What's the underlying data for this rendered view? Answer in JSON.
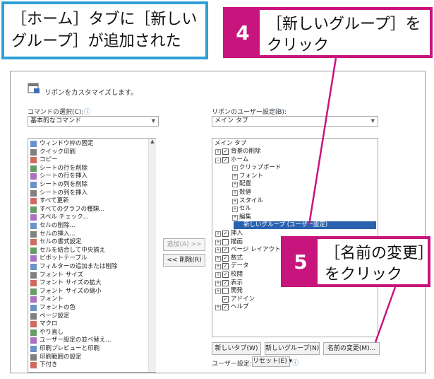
{
  "callout_blue": {
    "line1": "［ホーム］タブに［新しい",
    "line2": "グループ］が追加された"
  },
  "callout_4": {
    "num": "4",
    "line1": "［新しいグループ］を",
    "line2": "クリック"
  },
  "callout_5": {
    "num": "5",
    "line1": "［名前の変更］",
    "line2": "をクリック"
  },
  "dialog": {
    "title": "リボンをカスタマイズします。",
    "left_label": "コマンドの選択(C):",
    "left_combo": "基本的なコマンド",
    "right_label": "リボンのユーザー設定(B):",
    "right_combo": "メイン タブ",
    "commands": [
      "ウィンドウ枠の固定",
      "クイック印刷",
      "コピー",
      "シートの行を削除",
      "シートの行を挿入",
      "シートの列を削除",
      "シートの列を挿入",
      "すべて更新",
      "すべてのグラフの種類...",
      "スペル チェック...",
      "セルの削除...",
      "セルの挿入...",
      "セルの書式設定",
      "セルを結合して中央揃え",
      "ピボットテーブル",
      "フィルターの追加または削除",
      "フォント サイズ",
      "フォント サイズの拡大",
      "フォント サイズの縮小",
      "フォント",
      "フォントの色",
      "ページ設定",
      "マクロ",
      "やり直し",
      "ユーザー設定の並べ替え...",
      "印刷プレビューと印刷",
      "印刷範囲の設定",
      "下付き"
    ],
    "add_button": "追加(A) >>",
    "remove_button": "<< 削除(R)",
    "tree_header": "メイン タブ",
    "tree": [
      {
        "text": "背景の削除",
        "level": 0,
        "plus": true,
        "check": true
      },
      {
        "text": "ホーム",
        "level": 0,
        "plus": true,
        "check": true,
        "minus": true
      },
      {
        "text": "クリップボード",
        "level": 1,
        "plus": true
      },
      {
        "text": "フォント",
        "level": 1,
        "plus": true
      },
      {
        "text": "配置",
        "level": 1,
        "plus": true
      },
      {
        "text": "数値",
        "level": 1,
        "plus": true
      },
      {
        "text": "スタイル",
        "level": 1,
        "plus": true
      },
      {
        "text": "セル",
        "level": 1,
        "plus": true
      },
      {
        "text": "編集",
        "level": 1,
        "plus": true
      },
      {
        "text": "新しいグループ (ユーザー設定)",
        "level": 1,
        "selected": true
      },
      {
        "text": "挿入",
        "level": 0,
        "plus": true,
        "check": true
      },
      {
        "text": "描画",
        "level": 0,
        "plus": true,
        "check": false
      },
      {
        "text": "ページ レイアウト",
        "level": 0,
        "plus": true,
        "check": true
      },
      {
        "text": "数式",
        "level": 0,
        "plus": true,
        "check": true
      },
      {
        "text": "データ",
        "level": 0,
        "plus": true,
        "check": true
      },
      {
        "text": "校閲",
        "level": 0,
        "plus": true,
        "check": true
      },
      {
        "text": "表示",
        "level": 0,
        "plus": true,
        "check": true
      },
      {
        "text": "開発",
        "level": 0,
        "plus": true,
        "check": false
      },
      {
        "text": "アドイン",
        "level": 0,
        "plus": false,
        "check": true
      },
      {
        "text": "ヘルプ",
        "level": 0,
        "plus": true,
        "check": true
      }
    ],
    "new_tab_button": "新しいタブ(W)",
    "new_group_button": "新しいグループ(N)",
    "rename_button": "名前の変更(M)...",
    "user_setting_label": "ユーザー設定:",
    "reset_button": "リセット(E) ▾"
  }
}
